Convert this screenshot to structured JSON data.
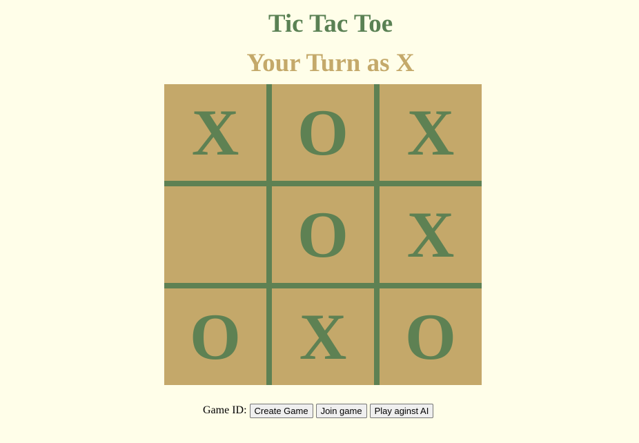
{
  "header": {
    "title": "Tic Tac Toe",
    "status": "Your Turn as X"
  },
  "board": {
    "cells": [
      [
        "X",
        "O",
        "X"
      ],
      [
        "",
        "O",
        "X"
      ],
      [
        "O",
        "X",
        "O"
      ]
    ]
  },
  "controls": {
    "game_id_label": "Game ID:",
    "create_label": "Create Game",
    "join_label": "Join game",
    "ai_label": "Play aginst AI"
  },
  "colors": {
    "background": "#fffee9",
    "title": "#5a8154",
    "status": "#c4a96a",
    "cell": "#c4a86a",
    "grid_and_marks": "#5e8153"
  }
}
